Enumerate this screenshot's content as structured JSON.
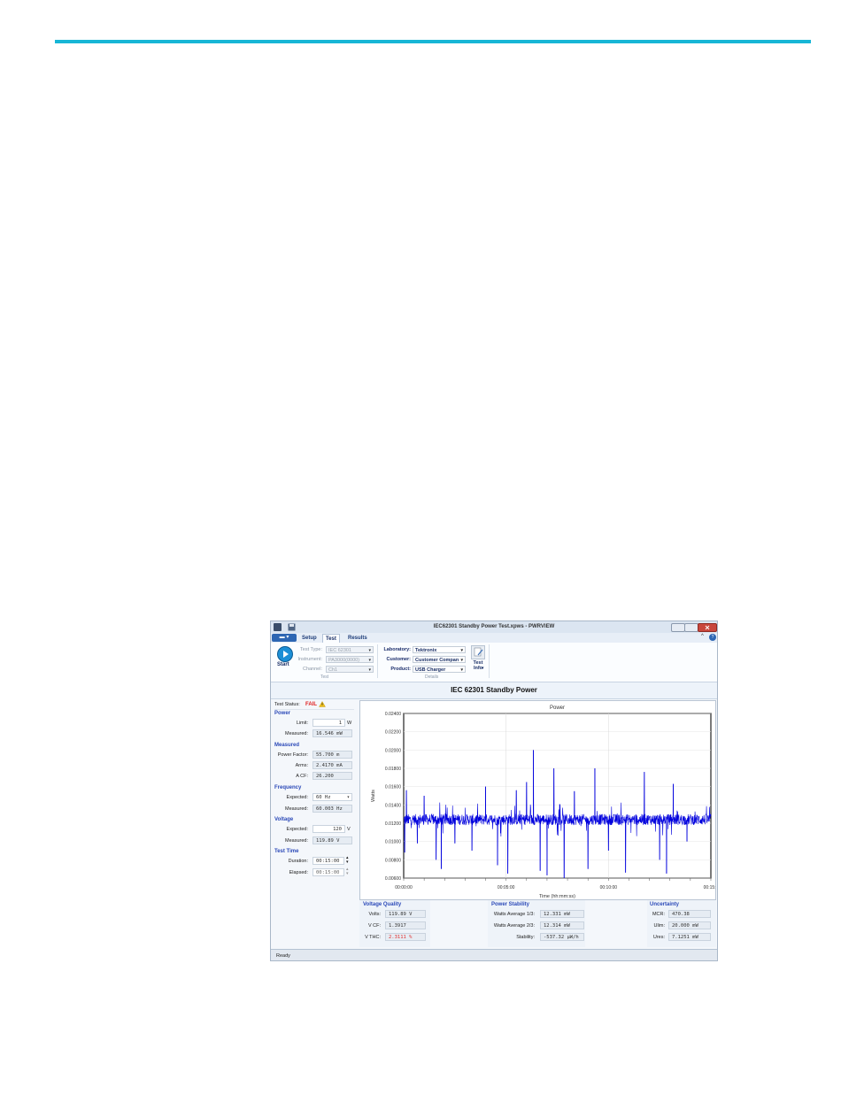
{
  "window": {
    "title": "IEC62301 Standby Power Test.xpws - PWRVIEW",
    "tabs": [
      "Setup",
      "Test",
      "Results"
    ],
    "active_tab": "Test"
  },
  "ribbon": {
    "start_label": "Start",
    "test_group": {
      "label": "Test",
      "test_type_label": "Test Type:",
      "test_type_value": "IEC 62301",
      "instrument_label": "Instrument:",
      "instrument_value": "PA3000(0000)",
      "channel_label": "Channel:",
      "channel_value": "Ch1"
    },
    "details_group": {
      "label": "Details",
      "laboratory_label": "Laboratory:",
      "laboratory_value": "Tektronix",
      "customer_label": "Customer:",
      "customer_value": "Customer Compan",
      "product_label": "Product:",
      "product_value": "USB Charger",
      "test_info_label": "Test Info"
    }
  },
  "header": {
    "title": "IEC 62301 Standby Power"
  },
  "left": {
    "test_status_label": "Test Status:",
    "test_status_value": "FAIL",
    "power": {
      "title": "Power",
      "limit_label": "Limit:",
      "limit_value": "1",
      "limit_unit": "W",
      "measured_label": "Measured:",
      "measured_value": "16.546 mW"
    },
    "measured": {
      "title": "Measured",
      "pf_label": "Power Factor:",
      "pf_value": "55.700 m",
      "arms_label": "Arms:",
      "arms_value": "2.4170 mA",
      "acf_label": "A CF:",
      "acf_value": "26.200"
    },
    "frequency": {
      "title": "Frequency",
      "expected_label": "Expected:",
      "expected_value": "60 Hz",
      "measured_label": "Measured:",
      "measured_value": "60.003 Hz"
    },
    "voltage": {
      "title": "Voltage",
      "expected_label": "Expected:",
      "expected_value": "120",
      "expected_unit": "V",
      "measured_label": "Measured:",
      "measured_value": "119.89 V"
    },
    "test_time": {
      "title": "Test Time",
      "duration_label": "Duration:",
      "duration_value": "00:15:00",
      "elapsed_label": "Elapsed:",
      "elapsed_value": "00:15:00"
    }
  },
  "chart_data": {
    "type": "line",
    "title": "Power",
    "xlabel": "Time (hh:mm:ss)",
    "ylabel": "Watts",
    "x_ticks": [
      "00:00:00",
      "00:05:00",
      "00:10:00",
      "00:15:0"
    ],
    "y_ticks": [
      "0.00600",
      "0.00800",
      "0.01000",
      "0.01200",
      "0.01400",
      "0.01600",
      "0.01800",
      "0.02000",
      "0.02200",
      "0.02400"
    ],
    "ylim": [
      0.006,
      0.024
    ],
    "xlim_seconds": [
      0,
      900
    ],
    "grid": true,
    "color": "#0000dd",
    "series": [
      {
        "baseline": 0.0124,
        "spikes": [
          [
            3,
            0.0088
          ],
          [
            8,
            0.0156
          ],
          [
            14,
            0.012
          ],
          [
            40,
            0.0098
          ],
          [
            60,
            0.015
          ],
          [
            95,
            0.008
          ],
          [
            110,
            0.007
          ],
          [
            150,
            0.0098
          ],
          [
            200,
            0.009
          ],
          [
            240,
            0.016
          ],
          [
            275,
            0.0074
          ],
          [
            305,
            0.0065
          ],
          [
            330,
            0.0156
          ],
          [
            360,
            0.0165
          ],
          [
            380,
            0.02
          ],
          [
            400,
            0.0068
          ],
          [
            420,
            0.0063
          ],
          [
            440,
            0.018
          ],
          [
            470,
            0.006
          ],
          [
            500,
            0.0155
          ],
          [
            540,
            0.007
          ],
          [
            560,
            0.018
          ],
          [
            600,
            0.009
          ],
          [
            650,
            0.0066
          ],
          [
            705,
            0.0176
          ],
          [
            750,
            0.008
          ],
          [
            770,
            0.0065
          ],
          [
            790,
            0.0163
          ],
          [
            830,
            0.01
          ],
          [
            870,
            0.012
          ]
        ]
      }
    ]
  },
  "bottom": {
    "voltage_quality": {
      "title": "Voltage Quality",
      "volts_label": "Volts:",
      "volts_value": "119.89 V",
      "vcf_label": "V CF:",
      "vcf_value": "1.3917",
      "vthc_label": "V THC:",
      "vthc_value": "2.3111 %"
    },
    "power_stability": {
      "title": "Power Stability",
      "wa1_label": "Watts Average 1/3:",
      "wa1_value": "12.331 mW",
      "wa2_label": "Watts Average 2/3:",
      "wa2_value": "12.314 mW",
      "stab_label": "Stability:",
      "stab_value": "-537.32 µW/h"
    },
    "uncertainty": {
      "title": "Uncertainty",
      "mcr_label": "MCR:",
      "mcr_value": "470.38",
      "ulim_label": "Ulim:",
      "ulim_value": "20.000 mW",
      "ures_label": "Ures:",
      "ures_value": "7.1251 mW"
    }
  },
  "status": {
    "text": "Ready"
  }
}
